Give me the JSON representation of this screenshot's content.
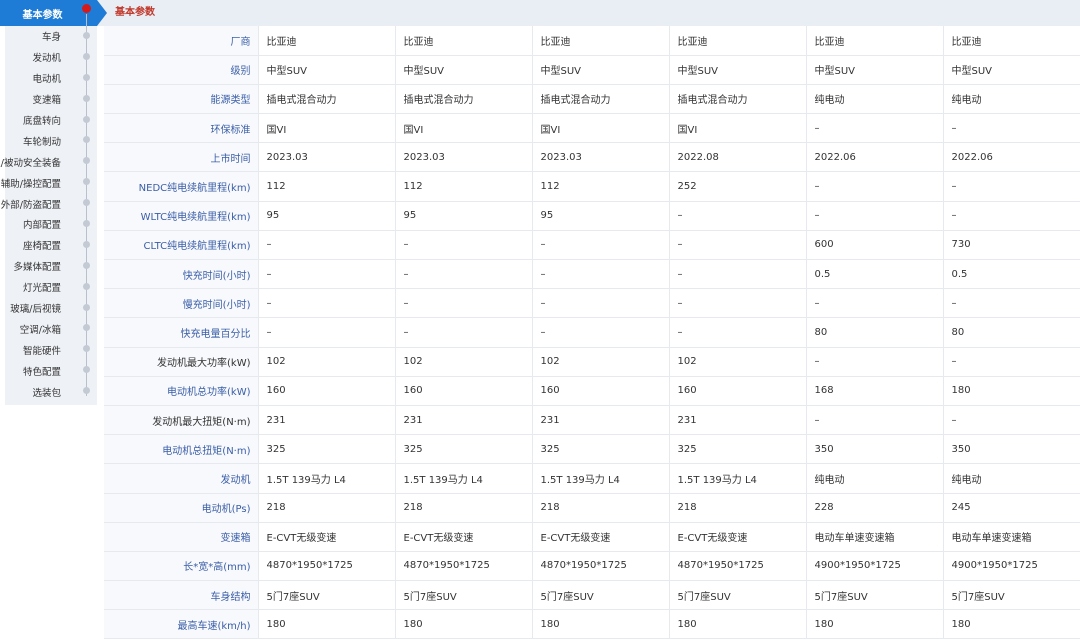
{
  "sidebar": {
    "header": "基本参数",
    "items": [
      "车身",
      "发动机",
      "电动机",
      "变速箱",
      "底盘转向",
      "车轮制动",
      "主/被动安全装备",
      "辅助/操控配置",
      "外部/防盗配置",
      "内部配置",
      "座椅配置",
      "多媒体配置",
      "灯光配置",
      "玻璃/后视镜",
      "空调/冰箱",
      "智能硬件",
      "特色配置",
      "选装包"
    ]
  },
  "section": {
    "title": "基本参数"
  },
  "table": {
    "rows": [
      {
        "label": "厂商",
        "color": "blue",
        "values": [
          "比亚迪",
          "比亚迪",
          "比亚迪",
          "比亚迪",
          "比亚迪",
          "比亚迪"
        ]
      },
      {
        "label": "级别",
        "color": "blue",
        "values": [
          "中型SUV",
          "中型SUV",
          "中型SUV",
          "中型SUV",
          "中型SUV",
          "中型SUV"
        ]
      },
      {
        "label": "能源类型",
        "color": "blue",
        "values": [
          "插电式混合动力",
          "插电式混合动力",
          "插电式混合动力",
          "插电式混合动力",
          "纯电动",
          "纯电动"
        ]
      },
      {
        "label": "环保标准",
        "color": "blue",
        "values": [
          "国VI",
          "国VI",
          "国VI",
          "国VI",
          "–",
          "–"
        ]
      },
      {
        "label": "上市时间",
        "color": "blue",
        "values": [
          "2023.03",
          "2023.03",
          "2023.03",
          "2022.08",
          "2022.06",
          "2022.06"
        ]
      },
      {
        "label": "NEDC纯电续航里程(km)",
        "color": "blue",
        "values": [
          "112",
          "112",
          "112",
          "252",
          "–",
          "–"
        ]
      },
      {
        "label": "WLTC纯电续航里程(km)",
        "color": "blue",
        "values": [
          "95",
          "95",
          "95",
          "–",
          "–",
          "–"
        ]
      },
      {
        "label": "CLTC纯电续航里程(km)",
        "color": "blue",
        "values": [
          "–",
          "–",
          "–",
          "–",
          "600",
          "730"
        ]
      },
      {
        "label": "快充时间(小时)",
        "color": "blue",
        "values": [
          "–",
          "–",
          "–",
          "–",
          "0.5",
          "0.5"
        ]
      },
      {
        "label": "慢充时间(小时)",
        "color": "blue",
        "values": [
          "–",
          "–",
          "–",
          "–",
          "–",
          "–"
        ]
      },
      {
        "label": "快充电量百分比",
        "color": "blue",
        "values": [
          "–",
          "–",
          "–",
          "–",
          "80",
          "80"
        ]
      },
      {
        "label": "发动机最大功率(kW)",
        "color": "dark",
        "values": [
          "102",
          "102",
          "102",
          "102",
          "–",
          "–"
        ]
      },
      {
        "label": "电动机总功率(kW)",
        "color": "blue",
        "values": [
          "160",
          "160",
          "160",
          "160",
          "168",
          "180"
        ]
      },
      {
        "label": "发动机最大扭矩(N·m)",
        "color": "dark",
        "values": [
          "231",
          "231",
          "231",
          "231",
          "–",
          "–"
        ]
      },
      {
        "label": "电动机总扭矩(N·m)",
        "color": "blue",
        "values": [
          "325",
          "325",
          "325",
          "325",
          "350",
          "350"
        ]
      },
      {
        "label": "发动机",
        "color": "blue",
        "values": [
          "1.5T 139马力 L4",
          "1.5T 139马力 L4",
          "1.5T 139马力 L4",
          "1.5T 139马力 L4",
          "纯电动",
          "纯电动"
        ]
      },
      {
        "label": "电动机(Ps)",
        "color": "blue",
        "values": [
          "218",
          "218",
          "218",
          "218",
          "228",
          "245"
        ]
      },
      {
        "label": "变速箱",
        "color": "blue",
        "values": [
          "E-CVT无级变速",
          "E-CVT无级变速",
          "E-CVT无级变速",
          "E-CVT无级变速",
          "电动车单速变速箱",
          "电动车单速变速箱"
        ]
      },
      {
        "label": "长*宽*高(mm)",
        "color": "blue",
        "values": [
          "4870*1950*1725",
          "4870*1950*1725",
          "4870*1950*1725",
          "4870*1950*1725",
          "4900*1950*1725",
          "4900*1950*1725"
        ]
      },
      {
        "label": "车身结构",
        "color": "blue",
        "values": [
          "5门7座SUV",
          "5门7座SUV",
          "5门7座SUV",
          "5门7座SUV",
          "5门7座SUV",
          "5门7座SUV"
        ]
      },
      {
        "label": "最高车速(km/h)",
        "color": "blue",
        "values": [
          "180",
          "180",
          "180",
          "180",
          "180",
          "180"
        ]
      }
    ]
  },
  "colors": {
    "accent": "#1e7cd6",
    "label_blue": "#3b5ea8",
    "section_title": "#c0392b",
    "marker": "#d61a1a"
  }
}
